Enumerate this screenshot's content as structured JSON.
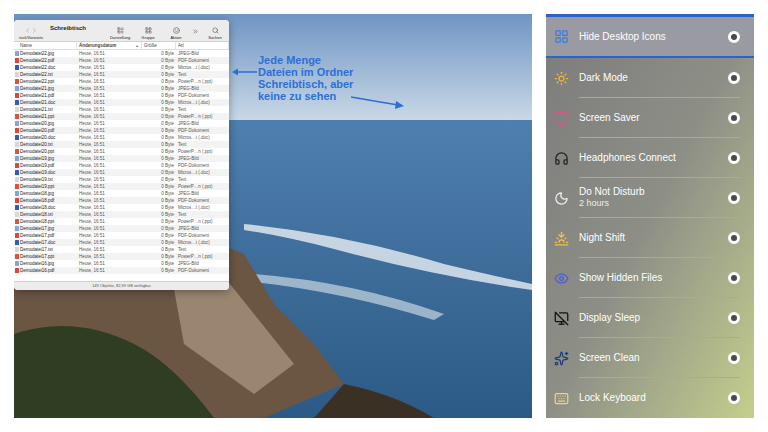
{
  "finder": {
    "title": "Schreibtisch",
    "toolbar": [
      {
        "label": "rück/Vorwärts"
      },
      {
        "label": "Darstellung"
      },
      {
        "label": "Gruppe"
      },
      {
        "label": "Aktion"
      },
      {
        "label": "Suchen"
      }
    ],
    "columns": [
      {
        "label": "Name",
        "sorted": false
      },
      {
        "label": "Änderungsdatum",
        "sorted": true
      },
      {
        "label": "Größe",
        "sorted": false
      },
      {
        "label": "Art",
        "sorted": false
      }
    ],
    "sort_mark": "⌄",
    "rows": [
      {
        "name": "Demodatei22.jpg",
        "date": "Heute, 16:51",
        "size": "0 Byte",
        "kind": "JPEG-Bild",
        "color": "#7fa7d9"
      },
      {
        "name": "Demodatei22.pdf",
        "date": "Heute, 16:51",
        "size": "0 Byte",
        "kind": "PDF-Dokument",
        "color": "#e0453a"
      },
      {
        "name": "Demodatei22.doc",
        "date": "Heute, 16:51",
        "size": "0 Byte",
        "kind": "Micros…t (.doc)",
        "color": "#2f5fb3"
      },
      {
        "name": "Demodatei22.txt",
        "date": "Heute, 16:51",
        "size": "0 Byte",
        "kind": "Text",
        "color": "#d8d8d8"
      },
      {
        "name": "Demodatei22.ppt",
        "date": "Heute, 16:51",
        "size": "0 Byte",
        "kind": "PowerP…n (.ppt)",
        "color": "#d8553a"
      },
      {
        "name": "Demodatei21.jpg",
        "date": "Heute, 16:51",
        "size": "0 Byte",
        "kind": "JPEG-Bild",
        "color": "#7fa7d9"
      },
      {
        "name": "Demodatei21.pdf",
        "date": "Heute, 16:51",
        "size": "0 Byte",
        "kind": "PDF-Dokument",
        "color": "#e0453a"
      },
      {
        "name": "Demodatei21.doc",
        "date": "Heute, 16:51",
        "size": "0 Byte",
        "kind": "Micros…t (.doc)",
        "color": "#2f5fb3"
      },
      {
        "name": "Demodatei21.txt",
        "date": "Heute, 16:51",
        "size": "0 Byte",
        "kind": "Text",
        "color": "#d8d8d8"
      },
      {
        "name": "Demodatei21.ppt",
        "date": "Heute, 16:51",
        "size": "0 Byte",
        "kind": "PowerP…n (.ppt)",
        "color": "#d8553a"
      },
      {
        "name": "Demodatei20.jpg",
        "date": "Heute, 16:51",
        "size": "0 Byte",
        "kind": "JPEG-Bild",
        "color": "#7fa7d9"
      },
      {
        "name": "Demodatei20.pdf",
        "date": "Heute, 16:51",
        "size": "0 Byte",
        "kind": "PDF-Dokument",
        "color": "#e0453a"
      },
      {
        "name": "Demodatei20.doc",
        "date": "Heute, 16:51",
        "size": "0 Byte",
        "kind": "Micros…t (.doc)",
        "color": "#2f5fb3"
      },
      {
        "name": "Demodatei20.txt",
        "date": "Heute, 16:51",
        "size": "0 Byte",
        "kind": "Text",
        "color": "#d8d8d8"
      },
      {
        "name": "Demodatei20.ppt",
        "date": "Heute, 16:51",
        "size": "0 Byte",
        "kind": "PowerP…n (.ppt)",
        "color": "#d8553a"
      },
      {
        "name": "Demodatei19.jpg",
        "date": "Heute, 16:51",
        "size": "0 Byte",
        "kind": "JPEG-Bild",
        "color": "#7fa7d9"
      },
      {
        "name": "Demodatei19.pdf",
        "date": "Heute, 16:51",
        "size": "0 Byte",
        "kind": "PDF-Dokument",
        "color": "#e0453a"
      },
      {
        "name": "Demodatei19.doc",
        "date": "Heute, 16:51",
        "size": "0 Byte",
        "kind": "Micros…t (.doc)",
        "color": "#2f5fb3"
      },
      {
        "name": "Demodatei19.txt",
        "date": "Heute, 16:51",
        "size": "0 Byte",
        "kind": "Text",
        "color": "#d8d8d8"
      },
      {
        "name": "Demodatei19.ppt",
        "date": "Heute, 16:51",
        "size": "0 Byte",
        "kind": "PowerP…n (.ppt)",
        "color": "#d8553a"
      },
      {
        "name": "Demodatei18.jpg",
        "date": "Heute, 16:51",
        "size": "0 Byte",
        "kind": "JPEG-Bild",
        "color": "#7fa7d9"
      },
      {
        "name": "Demodatei18.pdf",
        "date": "Heute, 16:51",
        "size": "0 Byte",
        "kind": "PDF-Dokument",
        "color": "#e0453a"
      },
      {
        "name": "Demodatei18.doc",
        "date": "Heute, 16:51",
        "size": "0 Byte",
        "kind": "Micros…t (.doc)",
        "color": "#2f5fb3"
      },
      {
        "name": "Demodatei18.txt",
        "date": "Heute, 16:51",
        "size": "0 Byte",
        "kind": "Text",
        "color": "#d8d8d8"
      },
      {
        "name": "Demodatei18.ppt",
        "date": "Heute, 16:51",
        "size": "0 Byte",
        "kind": "PowerP…n (.ppt)",
        "color": "#d8553a"
      },
      {
        "name": "Demodatei17.jpg",
        "date": "Heute, 16:51",
        "size": "0 Byte",
        "kind": "JPEG-Bild",
        "color": "#7fa7d9"
      },
      {
        "name": "Demodatei17.pdf",
        "date": "Heute, 16:51",
        "size": "0 Byte",
        "kind": "PDF-Dokument",
        "color": "#e0453a"
      },
      {
        "name": "Demodatei17.doc",
        "date": "Heute, 16:51",
        "size": "0 Byte",
        "kind": "Micros…t (.doc)",
        "color": "#2f5fb3"
      },
      {
        "name": "Demodatei17.txt",
        "date": "Heute, 16:51",
        "size": "0 Byte",
        "kind": "Text",
        "color": "#d8d8d8"
      },
      {
        "name": "Demodatei17.ppt",
        "date": "Heute, 16:51",
        "size": "0 Byte",
        "kind": "PowerP…n (.ppt)",
        "color": "#d8553a"
      },
      {
        "name": "Demodatei16.jpg",
        "date": "Heute, 16:51",
        "size": "0 Byte",
        "kind": "JPEG-Bild",
        "color": "#7fa7d9"
      },
      {
        "name": "Demodatei16.pdf",
        "date": "Heute, 16:51",
        "size": "0 Byte",
        "kind": "PDF-Dokument",
        "color": "#e0453a"
      }
    ],
    "status": "149 Objekte, 82,99 GB verfügbar"
  },
  "annotation": {
    "lines": [
      "Jede Menge",
      "Dateien im Ordner",
      "Schreibtisch, aber",
      "keine zu sehen"
    ]
  },
  "switches": [
    {
      "label": "Hide Desktop Icons",
      "subtitle": "",
      "on": false,
      "selected": true
    },
    {
      "label": "Dark Mode",
      "subtitle": "",
      "on": false,
      "selected": false
    },
    {
      "label": "Screen Saver",
      "subtitle": "",
      "on": false,
      "selected": false
    },
    {
      "label": "Headphones Connect",
      "subtitle": "",
      "on": false,
      "selected": false
    },
    {
      "label": "Do Not Disturb",
      "subtitle": "2 hours",
      "on": false,
      "selected": false
    },
    {
      "label": "Night Shift",
      "subtitle": "",
      "on": false,
      "selected": false
    },
    {
      "label": "Show Hidden Files",
      "subtitle": "",
      "on": false,
      "selected": false
    },
    {
      "label": "Display Sleep",
      "subtitle": "",
      "on": false,
      "selected": false
    },
    {
      "label": "Screen Clean",
      "subtitle": "",
      "on": false,
      "selected": false
    },
    {
      "label": "Lock Keyboard",
      "subtitle": "",
      "on": false,
      "selected": false
    }
  ]
}
